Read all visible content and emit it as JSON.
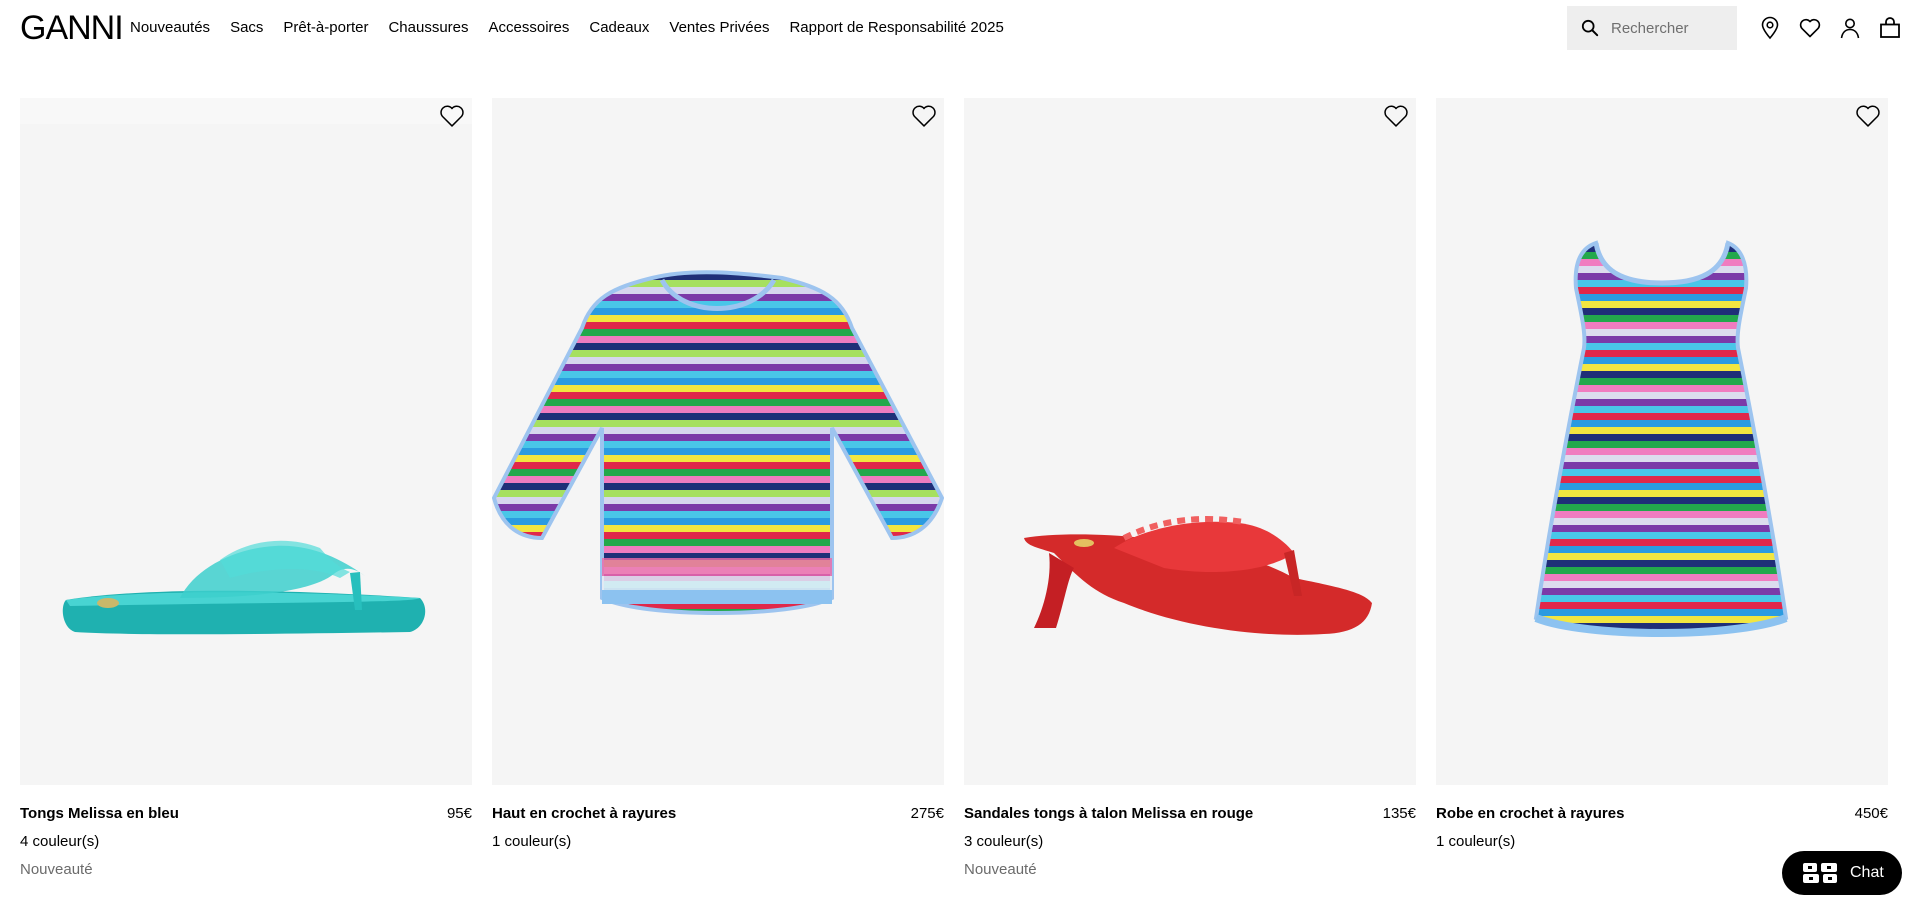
{
  "brand": "GANNI",
  "nav": [
    "Nouveautés",
    "Sacs",
    "Prêt-à-porter",
    "Chaussures",
    "Accessoires",
    "Cadeaux",
    "Ventes Privées",
    "Rapport de Responsabilité 2025"
  ],
  "search": {
    "placeholder": "Rechercher"
  },
  "header_icons": [
    "store-locator-icon",
    "wishlist-icon",
    "account-icon",
    "bag-icon"
  ],
  "products": [
    {
      "name": "Tongs Melissa en bleu",
      "price": "95€",
      "colors": "4 couleur(s)",
      "tag": "Nouveauté",
      "image": "turquoise-flip-flop"
    },
    {
      "name": "Haut en crochet à rayures",
      "price": "275€",
      "colors": "1 couleur(s)",
      "tag": "",
      "image": "striped-crochet-top"
    },
    {
      "name": "Sandales tongs à talon Melissa en rouge",
      "price": "135€",
      "colors": "3 couleur(s)",
      "tag": "Nouveauté",
      "image": "red-heeled-thong-sandal"
    },
    {
      "name": "Robe en crochet à rayures",
      "price": "450€",
      "colors": "1 couleur(s)",
      "tag": "",
      "image": "striped-crochet-dress"
    }
  ],
  "chat": {
    "label": "Chat"
  },
  "colors": {
    "card_bg": "#f5f5f5",
    "turquoise": "#2cc3c0",
    "red": "#e0302c",
    "chat_bg": "#000000"
  }
}
